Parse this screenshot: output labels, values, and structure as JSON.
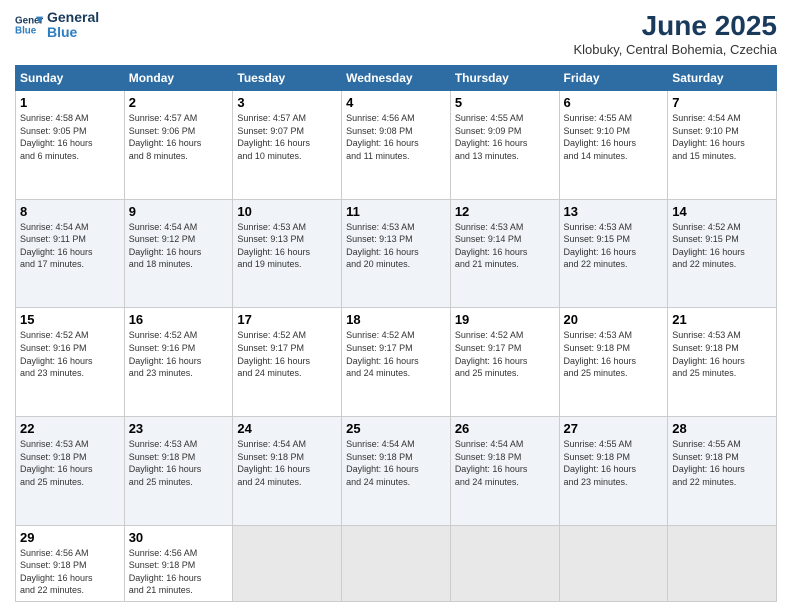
{
  "logo": {
    "line1": "General",
    "line2": "Blue"
  },
  "title": "June 2025",
  "location": "Klobuky, Central Bohemia, Czechia",
  "weekdays": [
    "Sunday",
    "Monday",
    "Tuesday",
    "Wednesday",
    "Thursday",
    "Friday",
    "Saturday"
  ],
  "weeks": [
    [
      {
        "day": "1",
        "info": "Sunrise: 4:58 AM\nSunset: 9:05 PM\nDaylight: 16 hours\nand 6 minutes."
      },
      {
        "day": "2",
        "info": "Sunrise: 4:57 AM\nSunset: 9:06 PM\nDaylight: 16 hours\nand 8 minutes."
      },
      {
        "day": "3",
        "info": "Sunrise: 4:57 AM\nSunset: 9:07 PM\nDaylight: 16 hours\nand 10 minutes."
      },
      {
        "day": "4",
        "info": "Sunrise: 4:56 AM\nSunset: 9:08 PM\nDaylight: 16 hours\nand 11 minutes."
      },
      {
        "day": "5",
        "info": "Sunrise: 4:55 AM\nSunset: 9:09 PM\nDaylight: 16 hours\nand 13 minutes."
      },
      {
        "day": "6",
        "info": "Sunrise: 4:55 AM\nSunset: 9:10 PM\nDaylight: 16 hours\nand 14 minutes."
      },
      {
        "day": "7",
        "info": "Sunrise: 4:54 AM\nSunset: 9:10 PM\nDaylight: 16 hours\nand 15 minutes."
      }
    ],
    [
      {
        "day": "8",
        "info": "Sunrise: 4:54 AM\nSunset: 9:11 PM\nDaylight: 16 hours\nand 17 minutes."
      },
      {
        "day": "9",
        "info": "Sunrise: 4:54 AM\nSunset: 9:12 PM\nDaylight: 16 hours\nand 18 minutes."
      },
      {
        "day": "10",
        "info": "Sunrise: 4:53 AM\nSunset: 9:13 PM\nDaylight: 16 hours\nand 19 minutes."
      },
      {
        "day": "11",
        "info": "Sunrise: 4:53 AM\nSunset: 9:13 PM\nDaylight: 16 hours\nand 20 minutes."
      },
      {
        "day": "12",
        "info": "Sunrise: 4:53 AM\nSunset: 9:14 PM\nDaylight: 16 hours\nand 21 minutes."
      },
      {
        "day": "13",
        "info": "Sunrise: 4:53 AM\nSunset: 9:15 PM\nDaylight: 16 hours\nand 22 minutes."
      },
      {
        "day": "14",
        "info": "Sunrise: 4:52 AM\nSunset: 9:15 PM\nDaylight: 16 hours\nand 22 minutes."
      }
    ],
    [
      {
        "day": "15",
        "info": "Sunrise: 4:52 AM\nSunset: 9:16 PM\nDaylight: 16 hours\nand 23 minutes."
      },
      {
        "day": "16",
        "info": "Sunrise: 4:52 AM\nSunset: 9:16 PM\nDaylight: 16 hours\nand 23 minutes."
      },
      {
        "day": "17",
        "info": "Sunrise: 4:52 AM\nSunset: 9:17 PM\nDaylight: 16 hours\nand 24 minutes."
      },
      {
        "day": "18",
        "info": "Sunrise: 4:52 AM\nSunset: 9:17 PM\nDaylight: 16 hours\nand 24 minutes."
      },
      {
        "day": "19",
        "info": "Sunrise: 4:52 AM\nSunset: 9:17 PM\nDaylight: 16 hours\nand 25 minutes."
      },
      {
        "day": "20",
        "info": "Sunrise: 4:53 AM\nSunset: 9:18 PM\nDaylight: 16 hours\nand 25 minutes."
      },
      {
        "day": "21",
        "info": "Sunrise: 4:53 AM\nSunset: 9:18 PM\nDaylight: 16 hours\nand 25 minutes."
      }
    ],
    [
      {
        "day": "22",
        "info": "Sunrise: 4:53 AM\nSunset: 9:18 PM\nDaylight: 16 hours\nand 25 minutes."
      },
      {
        "day": "23",
        "info": "Sunrise: 4:53 AM\nSunset: 9:18 PM\nDaylight: 16 hours\nand 25 minutes."
      },
      {
        "day": "24",
        "info": "Sunrise: 4:54 AM\nSunset: 9:18 PM\nDaylight: 16 hours\nand 24 minutes."
      },
      {
        "day": "25",
        "info": "Sunrise: 4:54 AM\nSunset: 9:18 PM\nDaylight: 16 hours\nand 24 minutes."
      },
      {
        "day": "26",
        "info": "Sunrise: 4:54 AM\nSunset: 9:18 PM\nDaylight: 16 hours\nand 24 minutes."
      },
      {
        "day": "27",
        "info": "Sunrise: 4:55 AM\nSunset: 9:18 PM\nDaylight: 16 hours\nand 23 minutes."
      },
      {
        "day": "28",
        "info": "Sunrise: 4:55 AM\nSunset: 9:18 PM\nDaylight: 16 hours\nand 22 minutes."
      }
    ],
    [
      {
        "day": "29",
        "info": "Sunrise: 4:56 AM\nSunset: 9:18 PM\nDaylight: 16 hours\nand 22 minutes."
      },
      {
        "day": "30",
        "info": "Sunrise: 4:56 AM\nSunset: 9:18 PM\nDaylight: 16 hours\nand 21 minutes."
      },
      {
        "day": "",
        "info": ""
      },
      {
        "day": "",
        "info": ""
      },
      {
        "day": "",
        "info": ""
      },
      {
        "day": "",
        "info": ""
      },
      {
        "day": "",
        "info": ""
      }
    ]
  ]
}
